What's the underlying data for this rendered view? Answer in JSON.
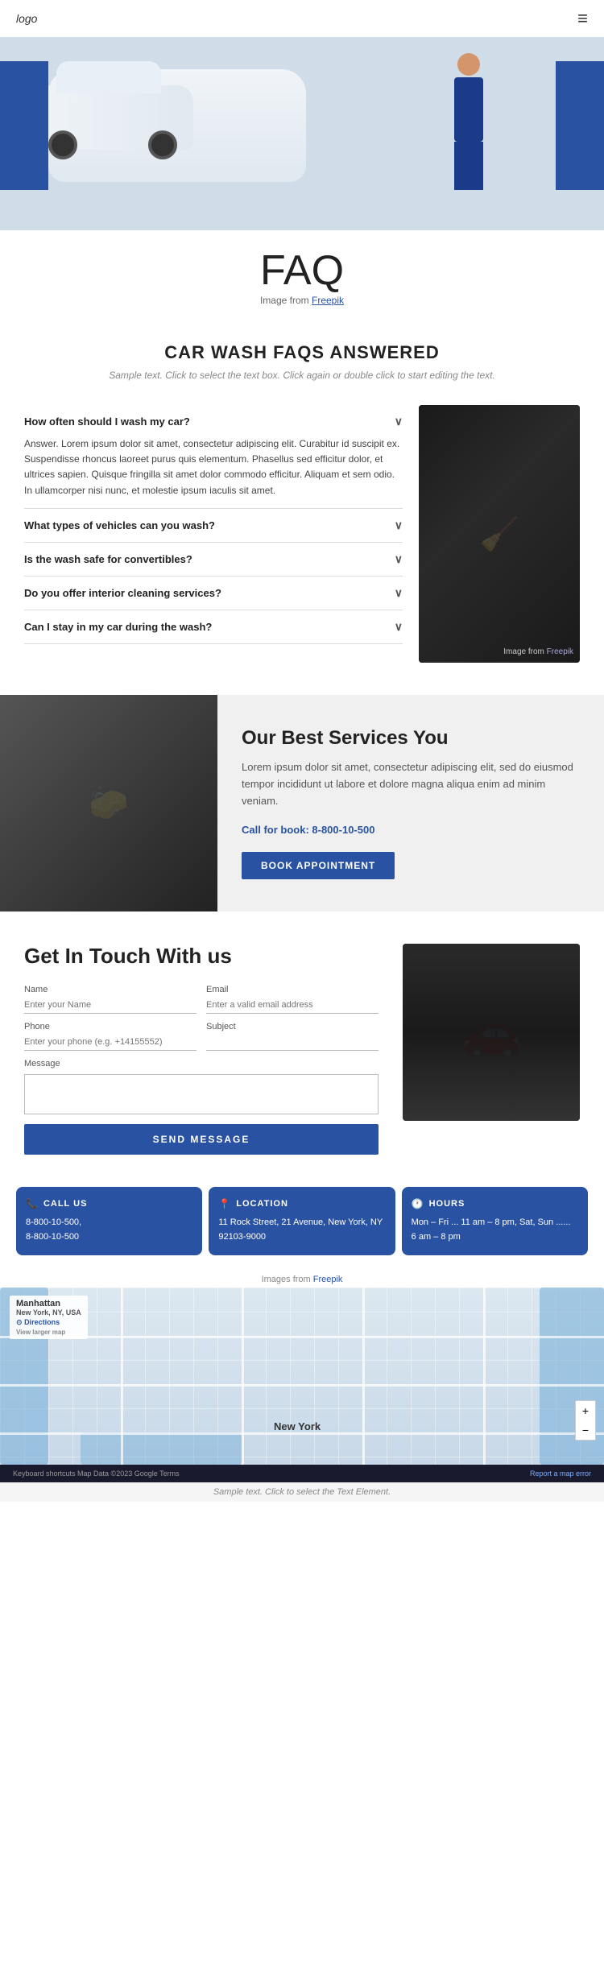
{
  "header": {
    "logo": "logo",
    "hamburger_icon": "≡"
  },
  "hero": {
    "faq_title": "FAQ",
    "image_credit_text": "Image from ",
    "image_credit_link": "Freepik"
  },
  "faqs_section": {
    "heading": "CAR WASH FAQS ANSWERED",
    "subtitle": "Sample text. Click to select the text box. Click again or double click to start editing the text.",
    "image_credit": "Image from ",
    "image_credit_link": "Freepik",
    "questions": [
      {
        "q": "How often should I wash my car?",
        "a": "Answer. Lorem ipsum dolor sit amet, consectetur adipiscing elit. Curabitur id suscipit ex. Suspendisse rhoncus laoreet purus quis elementum. Phasellus sed efficitur dolor, et ultrices sapien. Quisque fringilla sit amet dolor commodo efficitur. Aliquam et sem odio. In ullamcorper nisi nunc, et molestie ipsum iaculis sit amet.",
        "open": true
      },
      {
        "q": "What types of vehicles can you wash?",
        "a": "",
        "open": false
      },
      {
        "q": "Is the wash safe for convertibles?",
        "a": "",
        "open": false
      },
      {
        "q": "Do you offer interior cleaning services?",
        "a": "",
        "open": false
      },
      {
        "q": "Can I stay in my car during the wash?",
        "a": "",
        "open": false
      }
    ]
  },
  "services_section": {
    "heading": "Our Best Services You",
    "description": "Lorem ipsum dolor sit amet, consectetur adipiscing elit, sed do eiusmod tempor incididunt ut labore et dolore magna aliqua enim ad minim veniam.",
    "call_label": "Call for book: ",
    "phone": "8-800-10-500",
    "book_btn": "BOOK APPOINTMENT"
  },
  "contact_section": {
    "heading": "Get In Touch With us",
    "form": {
      "name_label": "Name",
      "name_placeholder": "Enter your Name",
      "email_label": "Email",
      "email_placeholder": "Enter a valid email address",
      "phone_label": "Phone",
      "phone_placeholder": "Enter your phone (e.g. +14155552)",
      "subject_label": "Subject",
      "subject_placeholder": "",
      "message_label": "Message",
      "send_btn": "SEND MESSAGE"
    }
  },
  "info_cards": [
    {
      "icon": "📞",
      "title": "CALL US",
      "lines": [
        "8-800-10-500,",
        "8-800-10-500"
      ]
    },
    {
      "icon": "📍",
      "title": "LOCATION",
      "lines": [
        "11 Rock Street, 21 Avenue, New York, NY",
        "92103-9000"
      ]
    },
    {
      "icon": "🕐",
      "title": "HOURS",
      "lines": [
        "Mon – Fri ... 11 am – 8 pm, Sat, Sun ......",
        "6 am – 8 pm"
      ]
    }
  ],
  "images_credit": "Images from ",
  "images_credit_link": "Freepik",
  "map": {
    "label": "Manhattan",
    "sublabel": "New York, NY, USA",
    "directions": "Directions",
    "city_label": "New York",
    "zoom_in": "+",
    "zoom_out": "−"
  },
  "footer": {
    "left_text": "Keyboard shortcuts   Map Data ©2023 Google   Terms",
    "right_text": "Report a map error"
  },
  "bottom_sample": "Sample text. Click to select the Text Element."
}
